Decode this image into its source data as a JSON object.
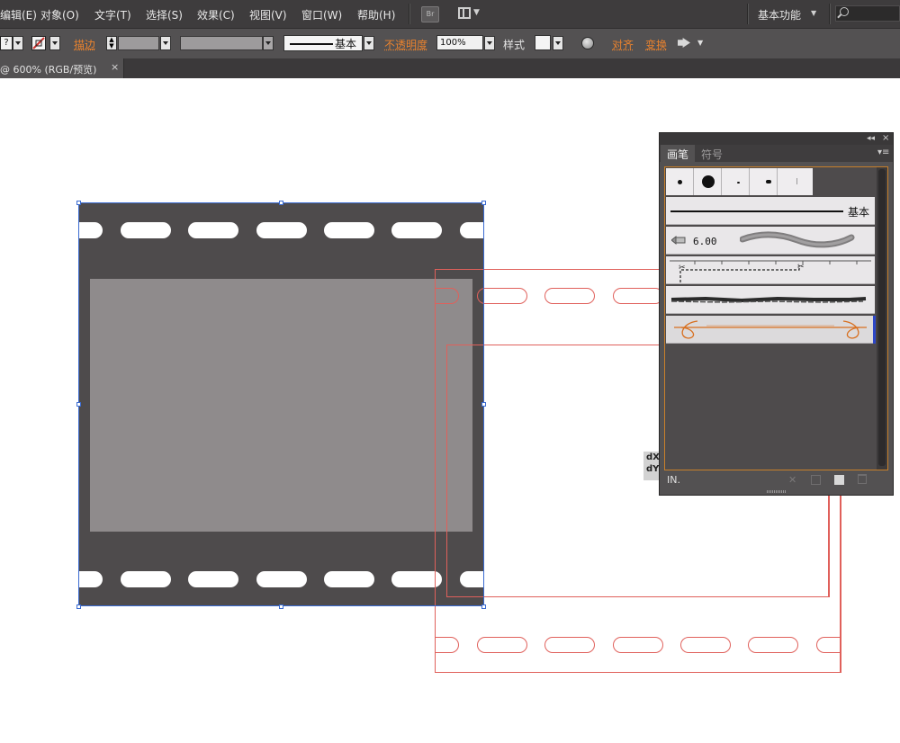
{
  "menubar": {
    "items": [
      "编辑(E)",
      "对象(O)",
      "文字(T)",
      "选择(S)",
      "效果(C)",
      "视图(V)",
      "窗口(W)",
      "帮助(H)"
    ],
    "bridge_label": "Br",
    "workspace_label": "基本功能"
  },
  "controlbar": {
    "fill_swatch_label": "?",
    "stroke_label": "描边",
    "stroke_profile_label": "基本",
    "opacity_label": "不透明度",
    "opacity_value": "100%",
    "style_label": "样式",
    "align_label": "对齐",
    "transform_label": "变换"
  },
  "document_tab": {
    "label": "@ 600% (RGB/预览)",
    "close": "×"
  },
  "canvas": {
    "dxdy_label_x": "dX",
    "dxdy_label_y": "dY"
  },
  "brushes_panel": {
    "tabs": [
      "画笔",
      "符号"
    ],
    "basic_brush_label": "基本",
    "bristle_size": "6.00",
    "collapse_glyph": "◂◂",
    "close_glyph": "×",
    "menu_glyph": "▾≡",
    "library_glyph": "IN."
  },
  "colors": {
    "menu_bg": "#3e3c3d",
    "control_bg": "#535152",
    "accent_orange": "#e9822e",
    "film_dark": "#4e4b4c",
    "film_frame": "#8f8b8c",
    "selection_blue": "#3a6bd1",
    "ghost_red": "#e0605b",
    "arrow_brush": "#d86f1f"
  }
}
